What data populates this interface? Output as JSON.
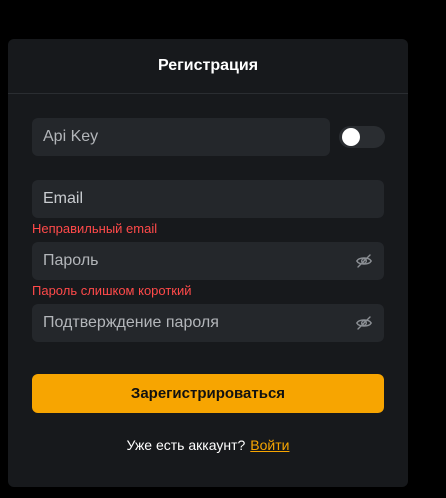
{
  "form": {
    "title": "Регистрация",
    "api_key": {
      "placeholder": "Api Key",
      "toggle_on": false
    },
    "email": {
      "placeholder": "Email",
      "error": "Неправильный email"
    },
    "password": {
      "placeholder": "Пароль",
      "error": "Пароль слишком короткий",
      "icon": "eye-off-icon"
    },
    "confirm_password": {
      "placeholder": "Подтверждение пароля",
      "icon": "eye-off-icon"
    },
    "submit_label": "Зарегистрироваться",
    "footer": {
      "text": "Уже есть аккаунт?",
      "link": "Войти"
    }
  },
  "colors": {
    "background": "#000000",
    "card": "#17191c",
    "field": "#24272b",
    "accent": "#f7a501",
    "error": "#ff4a4a"
  }
}
